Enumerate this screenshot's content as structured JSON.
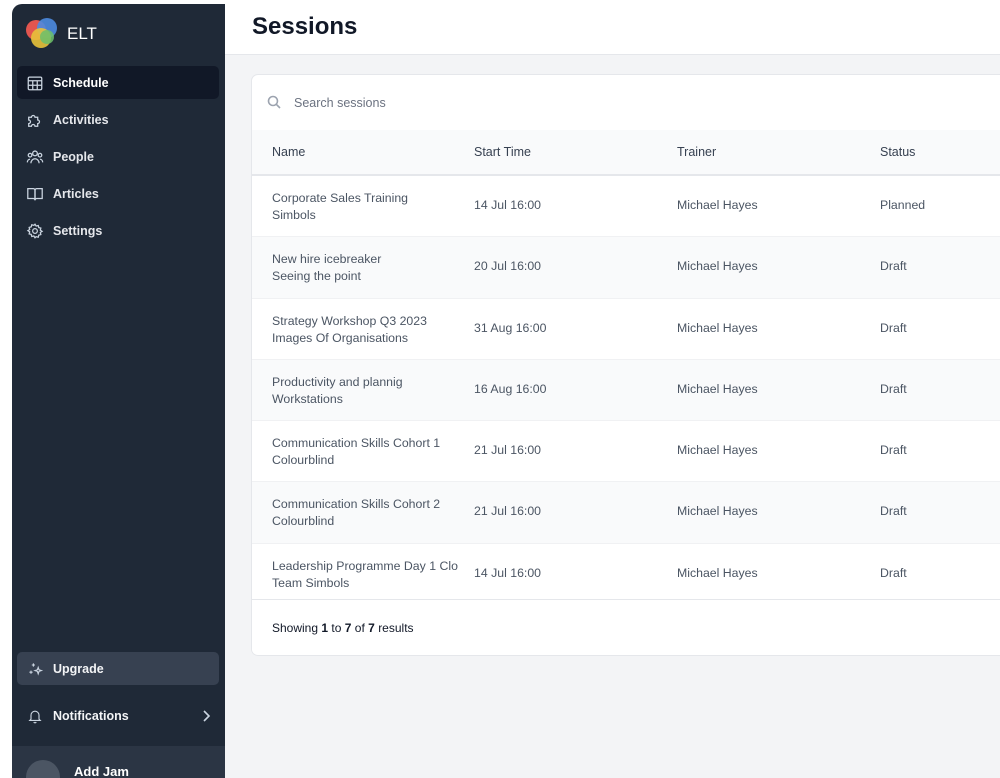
{
  "app": {
    "brand": "ELT"
  },
  "sidebar": {
    "items": [
      {
        "label": "Schedule",
        "icon": "calendar-icon",
        "active": true
      },
      {
        "label": "Activities",
        "icon": "puzzle-icon",
        "active": false
      },
      {
        "label": "People",
        "icon": "people-icon",
        "active": false
      },
      {
        "label": "Articles",
        "icon": "book-icon",
        "active": false
      },
      {
        "label": "Settings",
        "icon": "gear-icon",
        "active": false
      }
    ],
    "upgrade_label": "Upgrade",
    "notifications_label": "Notifications",
    "user_name": "Add Jam"
  },
  "page": {
    "title": "Sessions"
  },
  "search": {
    "placeholder": "Search sessions"
  },
  "table": {
    "columns": [
      "Name",
      "Start Time",
      "Trainer",
      "Status"
    ],
    "rows": [
      {
        "name": "Corporate Sales Training",
        "sub": "Simbols",
        "start": "14 Jul 16:00",
        "trainer": "Michael Hayes",
        "status": "Planned"
      },
      {
        "name": "New hire icebreaker",
        "sub": "Seeing the point",
        "start": "20 Jul 16:00",
        "trainer": "Michael Hayes",
        "status": "Draft"
      },
      {
        "name": "Strategy Workshop Q3 2023",
        "sub": "Images Of Organisations",
        "start": "31 Aug 16:00",
        "trainer": "Michael Hayes",
        "status": "Draft"
      },
      {
        "name": "Productivity and plannig",
        "sub": "Workstations",
        "start": "16 Aug 16:00",
        "trainer": "Michael Hayes",
        "status": "Draft"
      },
      {
        "name": "Communication Skills Cohort 1",
        "sub": "Colourblind",
        "start": "21 Jul 16:00",
        "trainer": "Michael Hayes",
        "status": "Draft"
      },
      {
        "name": "Communication Skills Cohort 2",
        "sub": "Colourblind",
        "start": "21 Jul 16:00",
        "trainer": "Michael Hayes",
        "status": "Draft"
      },
      {
        "name": "Leadership Programme Day 1 Clo",
        "sub": "Team Simbols",
        "start": "14 Jul 16:00",
        "trainer": "Michael Hayes",
        "status": "Draft"
      }
    ]
  },
  "pagination": {
    "prefix": "Showing",
    "from": "1",
    "to_word": "to",
    "to": "7",
    "of_word": "of",
    "total": "7",
    "suffix": "results"
  },
  "colors": {
    "sidebar_bg": "#1f2937",
    "active_item_bg": "#111827",
    "main_bg": "#f3f4f6"
  }
}
